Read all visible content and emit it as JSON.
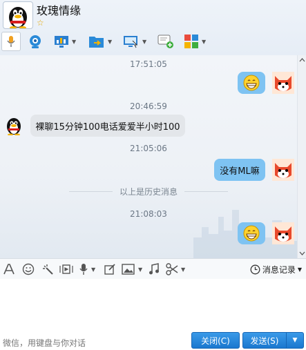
{
  "header": {
    "contact_name": "玫瑰情缘",
    "star": "☆",
    "toolbar_icons": [
      "microphone-icon",
      "video-camera-icon",
      "screen-share-icon",
      "send-file-icon",
      "remote-desktop-icon",
      "new-message-icon",
      "app-grid-icon"
    ]
  },
  "chat": {
    "messages": [
      {
        "time": "17:51:05",
        "sender": "self",
        "content": "grin-emoji"
      },
      {
        "time": "20:46:59",
        "sender": "contact",
        "text": "裸聊15分钟100电话爱爱半小时100"
      },
      {
        "time": "21:05:06",
        "sender": "self",
        "text": "没有ML嘛"
      },
      {
        "time": "21:08:03",
        "sender": "self",
        "content": "grin-emoji"
      }
    ],
    "history_divider": "以上是历史消息"
  },
  "input_toolbar": {
    "icons": [
      "font-icon",
      "emoji-icon",
      "magic-wand-icon",
      "animation-icon",
      "voice-icon",
      "screenshot-edit-icon",
      "image-icon",
      "music-icon",
      "scissors-icon"
    ],
    "history_label": "消息记录"
  },
  "footer": {
    "hint": "微信，用键盘与你对话",
    "close_label": "关闭(C)",
    "send_label": "发送(S)"
  },
  "colors": {
    "self_bubble": "#7ec3f2",
    "contact_bubble": "#e3e6ea",
    "button": "#1a78cf"
  }
}
